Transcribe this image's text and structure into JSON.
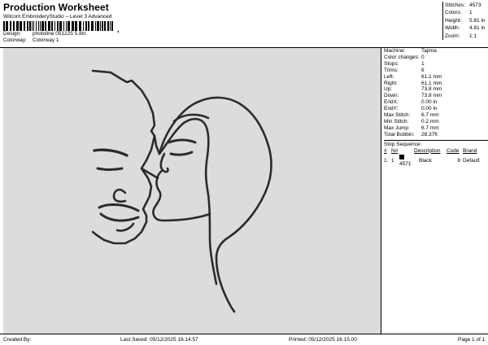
{
  "header": {
    "title": "Production Worksheet",
    "subtitle": "Wilcom EmbroideryStudio – Level 3 Advanced",
    "barcode_text": ",",
    "design_label": "Design:",
    "design_value": "photoline 051225 5,8in",
    "colorway_label": "Colorway:",
    "colorway_value": "Colorway 1"
  },
  "summary": [
    {
      "label": "Stitches:",
      "value": "4573"
    },
    {
      "label": "Colors:",
      "value": "1"
    },
    {
      "label": "Height:",
      "value": "5.81 in"
    },
    {
      "label": "Width:",
      "value": "4.81 in"
    },
    {
      "label": "Zoom:",
      "value": "1:1"
    }
  ],
  "machine_info": [
    {
      "label": "Machine:",
      "value": "Tajima"
    },
    {
      "label": "Color changes:",
      "value": "0"
    },
    {
      "label": "Stops:",
      "value": "1"
    },
    {
      "label": "Trims:",
      "value": "6"
    },
    {
      "label": "Left:",
      "value": "61.1 mm"
    },
    {
      "label": "Right:",
      "value": "61.1 mm"
    },
    {
      "label": "Up:",
      "value": "73.8 mm"
    },
    {
      "label": "Down:",
      "value": "73.8 mm"
    },
    {
      "label": "EndX:",
      "value": "0.00 in"
    },
    {
      "label": "EndY:",
      "value": "0.00 in"
    },
    {
      "label": "Max Stitch:",
      "value": "6.7 mm"
    },
    {
      "label": "Min Stitch:",
      "value": "0.2 mm"
    },
    {
      "label": "Max Jump:",
      "value": "6.7 mm"
    },
    {
      "label": "Total Bobbin:",
      "value": "28.37ft"
    }
  ],
  "stop_sequence": {
    "title": "Stop Sequence:",
    "columns": [
      "#",
      "N#",
      "",
      "Description",
      "Code",
      "Brand"
    ],
    "rows": [
      {
        "index": "1.",
        "needle": "1",
        "stitches": "4571",
        "description": "Black",
        "code": "8",
        "brand": "Default",
        "color": "#000000"
      }
    ]
  },
  "footer": {
    "created": "Created By:",
    "last_saved": "Last Saved: 05/12/2025 16.14.57",
    "printed": "Printed: 05/12/2025 16.15.00",
    "page": "Page 1 of 1"
  },
  "colors": {
    "canvas_bg": "#dcdcdc",
    "thread": "#2b2b2b"
  }
}
